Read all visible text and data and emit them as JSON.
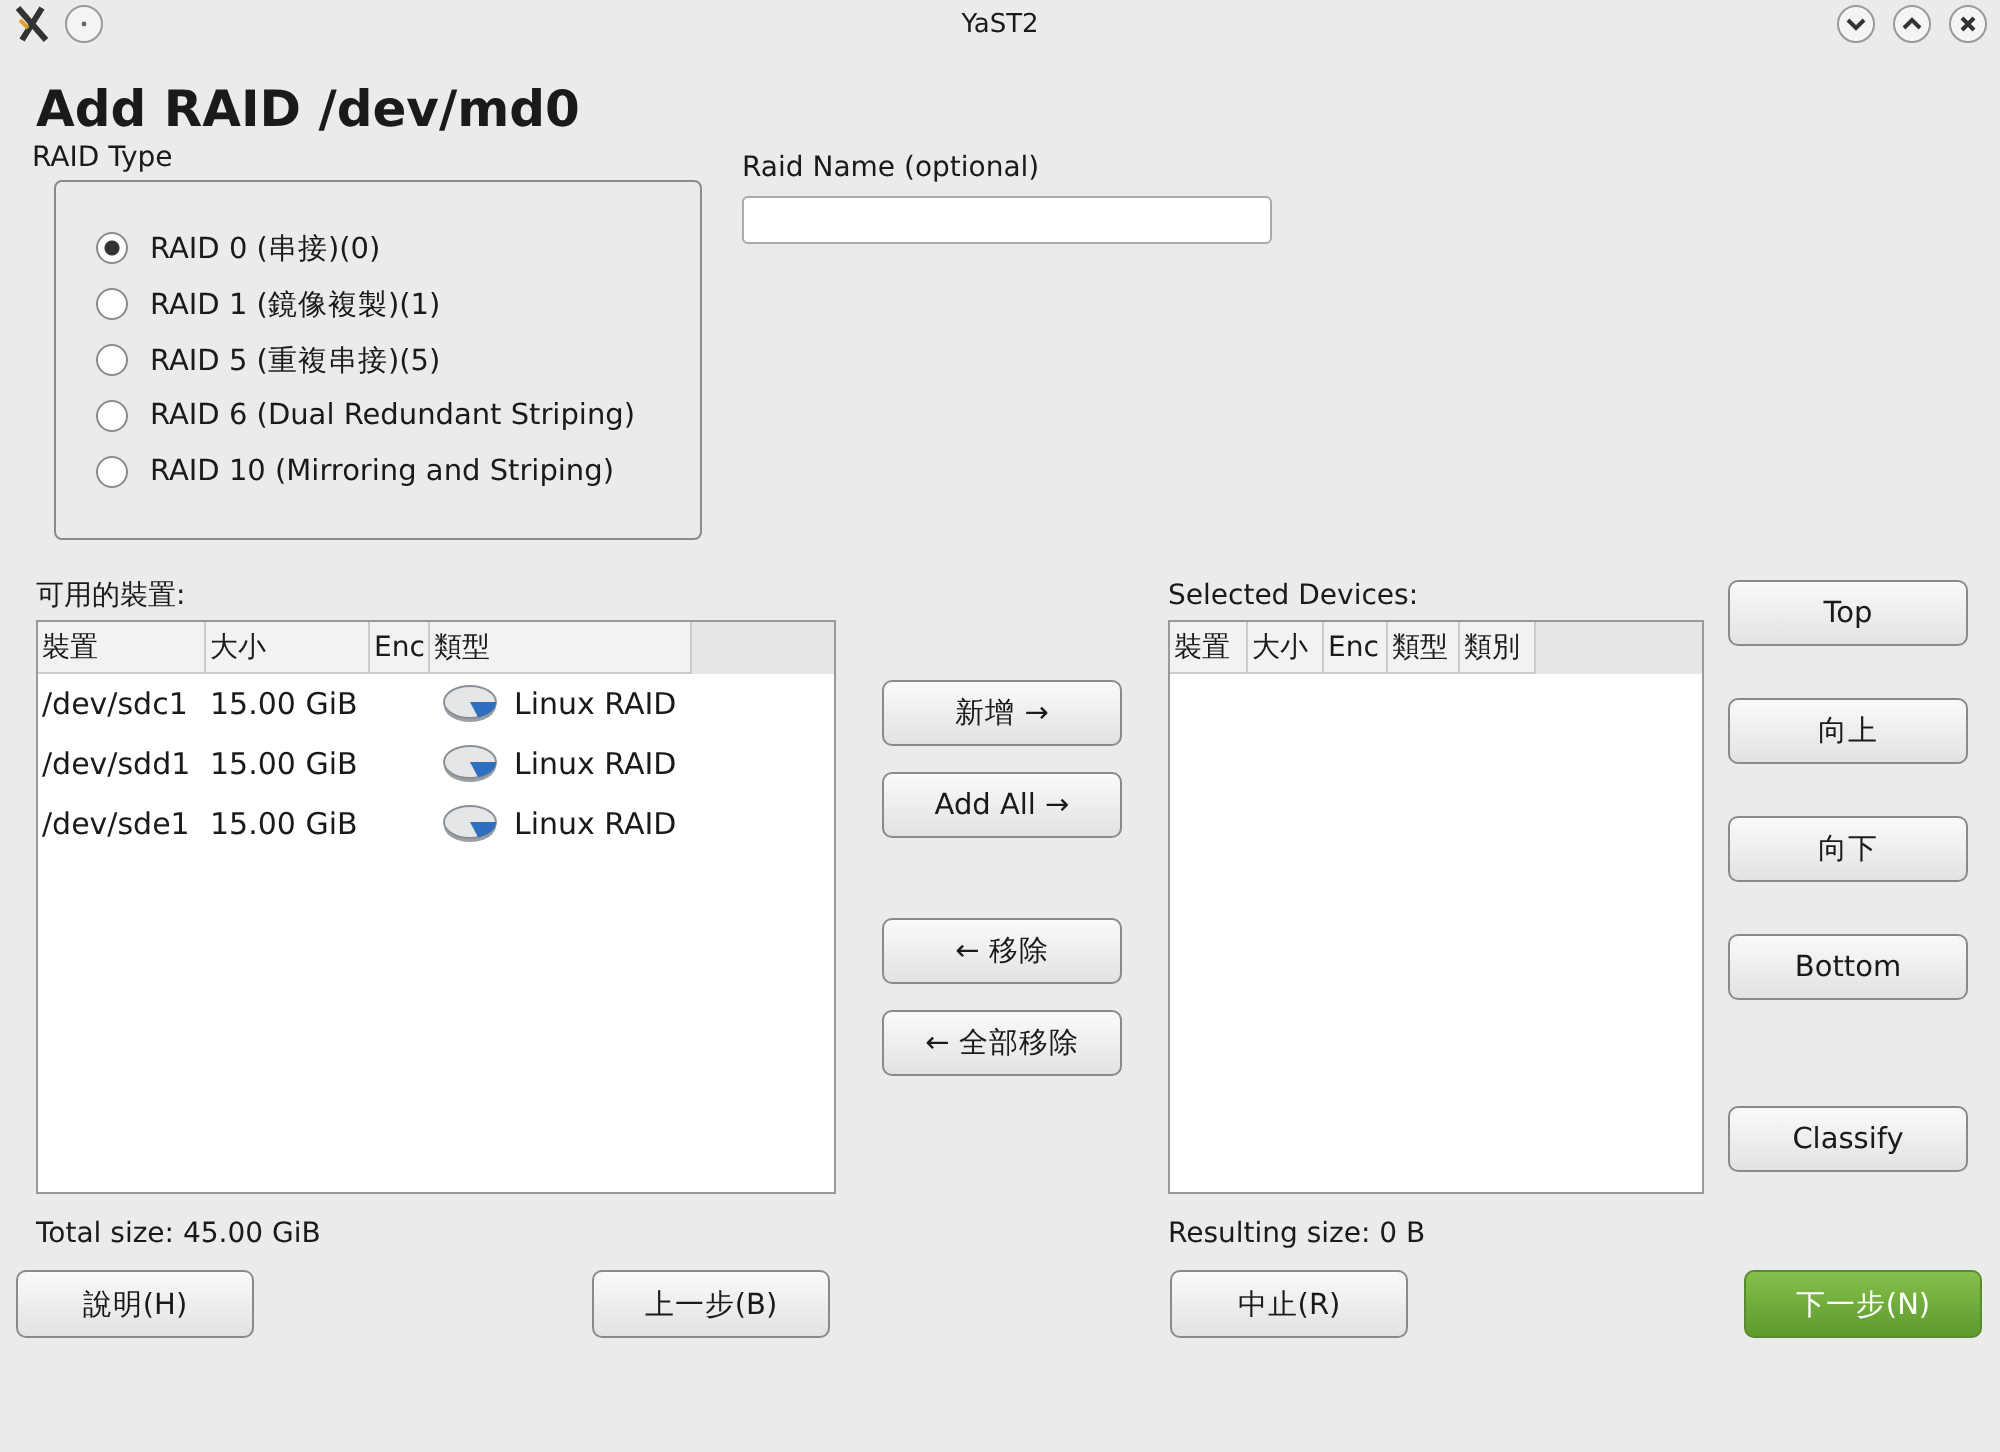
{
  "window": {
    "title": "YaST2"
  },
  "heading": "Add RAID /dev/md0",
  "raid_type": {
    "label": "RAID Type",
    "options": [
      {
        "label": "RAID 0 (串接)(0)",
        "selected": true
      },
      {
        "label": "RAID 1 (鏡像複製)(1)",
        "selected": false
      },
      {
        "label": "RAID 5 (重複串接)(5)",
        "selected": false
      },
      {
        "label": "RAID 6  (Dual Redundant Striping)",
        "selected": false
      },
      {
        "label": "RAID 10  (Mirroring and Striping)",
        "selected": false
      }
    ]
  },
  "raid_name": {
    "label": "Raid Name (optional)"
  },
  "available": {
    "label": "可用的裝置:",
    "columns": [
      "裝置",
      "大小",
      "Enc",
      "類型"
    ],
    "rows": [
      {
        "device": "/dev/sdc1",
        "size": "15.00 GiB",
        "type": "Linux RAID"
      },
      {
        "device": "/dev/sdd1",
        "size": "15.00 GiB",
        "type": "Linux RAID"
      },
      {
        "device": "/dev/sde1",
        "size": "15.00 GiB",
        "type": "Linux RAID"
      }
    ],
    "total": "Total size: 45.00 GiB"
  },
  "move_buttons": [
    "新增 →",
    "Add All →",
    "← 移除",
    "← 全部移除"
  ],
  "selected_devices": {
    "label": "Selected Devices:",
    "columns": [
      "裝置",
      "大小",
      "Enc",
      "類型",
      "類別"
    ],
    "total": "Resulting size: 0 B"
  },
  "order_buttons": [
    "Top",
    "向上",
    "向下",
    "Bottom",
    "Classify"
  ],
  "footer_buttons": [
    {
      "label": "說明(H)",
      "primary": false
    },
    {
      "label": "上一步(B)",
      "primary": false
    },
    {
      "label": "中止(R)",
      "primary": false
    },
    {
      "label": "下一步(N)",
      "primary": true
    }
  ]
}
